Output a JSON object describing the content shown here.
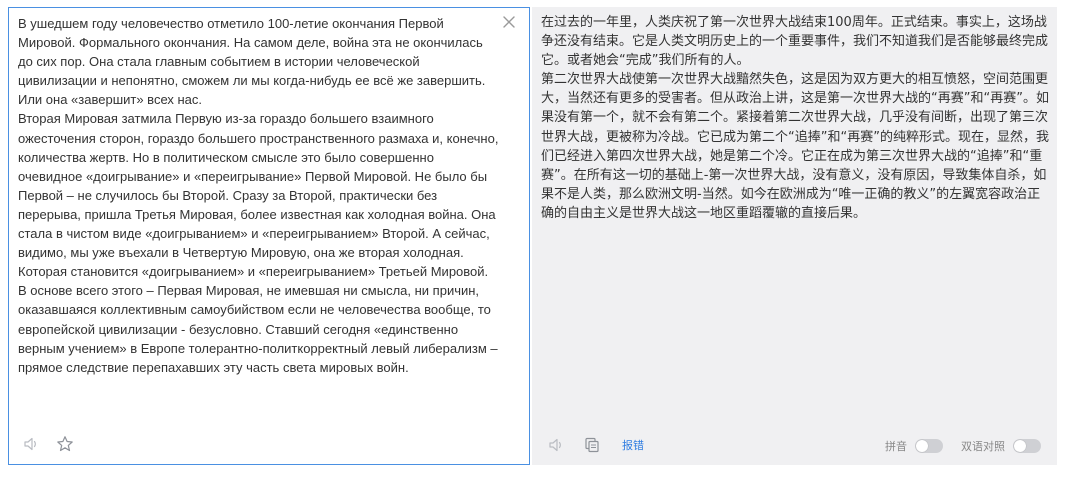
{
  "source": {
    "text": "В ушедшем году человечество отметило 100-летие окончания Первой Мировой. Формального окончания. На самом деле, война эта не окончилась до сих пор. Она стала главным событием в истории человеческой цивилизации и непонятно, сможем ли мы когда-нибудь ее всё же завершить. Или она «завершит» всех нас.\nВторая Мировая затмила Первую из-за гораздо большего взаимного ожесточения сторон, гораздо большего пространственного размаха и, конечно, количества жертв. Но в политическом смысле это было совершенно очевидное «доигрывание» и «переигрывание» Первой Мировой. Не было бы Первой – не случилось бы Второй. Сразу за Второй, практически без перерыва, пришла Третья Мировая, более известная как холодная война. Она стала в чистом виде «доигрыванием» и «переигрыванием» Второй. А сейчас, видимо, мы уже въехали в Четвертую Мировую, она же вторая холодная. Которая становится «доигрыванием» и «переигрыванием» Третьей Мировой. В основе всего этого – Первая Мировая, не имевшая ни смысла, ни причин, оказавшаяся коллективным самоубийством если не человечества вообще, то европейской цивилизации - безусловно. Ставший сегодня «единственно верным учением» в Европе толерантно-политкорректный левый либерализм – прямое следствие перепахавших эту часть света мировых войн."
  },
  "target": {
    "text": "在过去的一年里，人类庆祝了第一次世界大战结束100周年。正式结束。事实上，这场战争还没有结束。它是人类文明历史上的一个重要事件，我们不知道我们是否能够最终完成它。或者她会“完成”我们所有的人。\n第二次世界大战使第一次世界大战黯然失色，这是因为双方更大的相互愤怒，空间范围更大，当然还有更多的受害者。但从政治上讲，这是第一次世界大战的“再赛”和“再赛”。如果没有第一个，就不会有第二个。紧接着第二次世界大战，几乎没有间断，出现了第三次世界大战，更被称为冷战。它已成为第二个“追捧”和“再赛”的纯粹形式。现在，显然，我们已经进入第四次世界大战，她是第二个冷。它正在成为第三次世界大战的“追捧”和“重赛”。在所有这一切的基础上-第一次世界大战，没有意义，没有原因，导致集体自杀，如果不是人类，那么欧洲文明-当然。如今在欧洲成为“唯一正确的教义”的左翼宽容政治正确的自由主义是世界大战这一地区重蹈覆辙的直接后果。",
    "report_label": "报错",
    "pinyin_label": "拼音",
    "bilingual_label": "双语对照",
    "pinyin_on": false,
    "bilingual_on": false
  },
  "icons": {
    "clear": "close-icon",
    "speaker": "speaker-icon",
    "favorite": "star-icon",
    "copy": "copy-icon"
  },
  "colors": {
    "accent": "#4a90e2",
    "link": "#2f7de1",
    "target_bg": "#f0f0f2",
    "toggle_off": "#cfd0d4"
  }
}
